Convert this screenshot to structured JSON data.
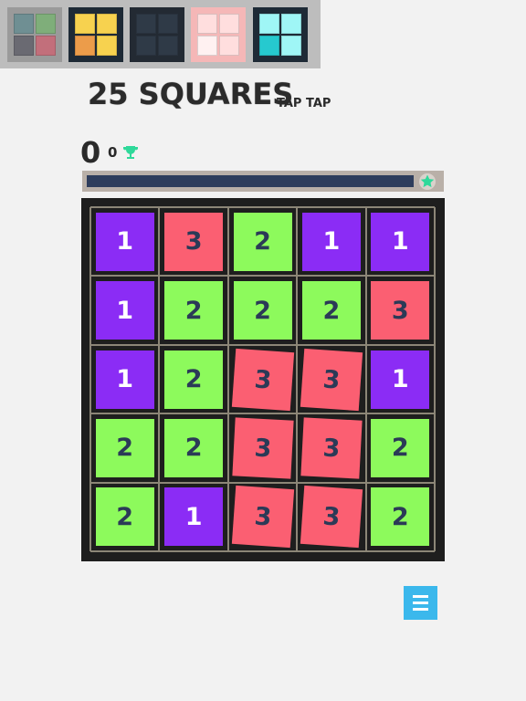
{
  "themes": [
    {
      "name": "muted",
      "frame": "#9a9a9a",
      "cells": [
        "#6f8f93",
        "#7fae7a",
        "#6a6a72",
        "#c26f7b"
      ],
      "selected": true
    },
    {
      "name": "sunny",
      "frame": "#1e2a36",
      "cells": [
        "#f7d24f",
        "#f7d24f",
        "#ec9c4a",
        "#f7d24f"
      ],
      "selected": false
    },
    {
      "name": "dark",
      "frame": "#232a33",
      "cells": [
        "#2f3a47",
        "#2f3a47",
        "#2f3a47",
        "#2f3a47"
      ],
      "selected": false
    },
    {
      "name": "blush",
      "frame": "#f5b7b7",
      "cells": [
        "#ffdede",
        "#ffdede",
        "#fff1f1",
        "#ffdede"
      ],
      "selected": false
    },
    {
      "name": "aqua",
      "frame": "#1e2a36",
      "cells": [
        "#9ff6f6",
        "#9ff6f6",
        "#26c9cf",
        "#9ff6f6"
      ],
      "selected": false
    }
  ],
  "title": "25 SQUARES",
  "subtitle": "TAP TAP",
  "score": "0",
  "best": "0",
  "icons": {
    "trophy": "trophy-icon",
    "star": "star-icon",
    "menu": "menu-icon"
  },
  "progress": {
    "fraction": 0.92
  },
  "colors": {
    "1": {
      "bg": "#8b2cf5",
      "fg": "#ffffff"
    },
    "2": {
      "bg": "#8dfa5c",
      "fg": "#2b3a57"
    },
    "3": {
      "bg": "#fb5f72",
      "fg": "#2b3a57"
    },
    "accent": "#3bb8ec",
    "trophy": "#2fd99a"
  },
  "board": [
    [
      "1",
      "3",
      "2",
      "1",
      "1"
    ],
    [
      "1",
      "2",
      "2",
      "2",
      "3"
    ],
    [
      "1",
      "2",
      "3",
      "3",
      "1"
    ],
    [
      "2",
      "2",
      "3",
      "3",
      "2"
    ],
    [
      "2",
      "1",
      "3",
      "3",
      "2"
    ]
  ],
  "tilted": [
    [
      2,
      2
    ],
    [
      2,
      3
    ],
    [
      3,
      2
    ],
    [
      3,
      3
    ],
    [
      4,
      2
    ],
    [
      4,
      3
    ]
  ]
}
